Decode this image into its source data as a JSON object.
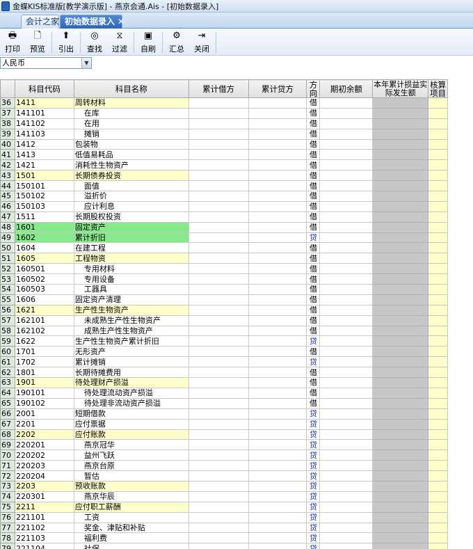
{
  "window": {
    "title": "金蝶KIS标准版[教学演示版] - 燕京会通.Ais - [初始数据录入]"
  },
  "tabs": [
    {
      "label": "会计之家"
    },
    {
      "label": "初始数据录入",
      "close": "✕"
    }
  ],
  "toolbar": [
    {
      "label": "打印",
      "icon": "printer-icon",
      "glyph": "🖶"
    },
    {
      "label": "预览",
      "icon": "preview-icon",
      "glyph": "🗋"
    },
    {
      "label": "引出",
      "icon": "export-icon",
      "glyph": "⬆"
    },
    {
      "label": "查找",
      "icon": "binoculars-icon",
      "glyph": "◎"
    },
    {
      "label": "过滤",
      "icon": "filter-icon",
      "glyph": "⧖"
    },
    {
      "label": "自刷",
      "icon": "refresh-icon",
      "glyph": "▣"
    },
    {
      "label": "汇总",
      "icon": "summary-icon",
      "glyph": "⚙"
    },
    {
      "label": "关闭",
      "icon": "close-door-icon",
      "glyph": "⇥"
    }
  ],
  "currency": {
    "selected": "人民币"
  },
  "columns": {
    "code": "科目代码",
    "name": "科目名称",
    "debit": "累计借方",
    "credit": "累计贷方",
    "direction": "方向",
    "opening": "期初余额",
    "pl": "本年累计损益实际发生额",
    "check": "核算项目"
  },
  "colors": {
    "level1_row": "#ffffcc",
    "selected_row": "#86e98c",
    "credit_text": "#1a2fb0"
  },
  "rows": [
    {
      "n": "36",
      "code": "1411",
      "name": "周转材料",
      "dir": "借",
      "lvl": 1
    },
    {
      "n": "37",
      "code": "141101",
      "name": "在库",
      "dir": "借",
      "lvl": 2
    },
    {
      "n": "38",
      "code": "141102",
      "name": "在用",
      "dir": "借",
      "lvl": 2
    },
    {
      "n": "39",
      "code": "141103",
      "name": "摊销",
      "dir": "借",
      "lvl": 2
    },
    {
      "n": "40",
      "code": "1412",
      "name": "包装物",
      "dir": "借",
      "lvl": 0
    },
    {
      "n": "41",
      "code": "1413",
      "name": "低值易耗品",
      "dir": "借",
      "lvl": 0
    },
    {
      "n": "42",
      "code": "1421",
      "name": "消耗性生物资产",
      "dir": "借",
      "lvl": 0
    },
    {
      "n": "43",
      "code": "1501",
      "name": "长期债券投资",
      "dir": "借",
      "lvl": 1
    },
    {
      "n": "44",
      "code": "150101",
      "name": "面值",
      "dir": "借",
      "lvl": 2
    },
    {
      "n": "45",
      "code": "150102",
      "name": "溢折价",
      "dir": "借",
      "lvl": 2
    },
    {
      "n": "46",
      "code": "150103",
      "name": "应计利息",
      "dir": "借",
      "lvl": 2
    },
    {
      "n": "47",
      "code": "1511",
      "name": "长期股权投资",
      "dir": "借",
      "lvl": 0
    },
    {
      "n": "48",
      "code": "1601",
      "name": "固定资产",
      "dir": "借",
      "lvl": 3
    },
    {
      "n": "49",
      "code": "1602",
      "name": "累计折旧",
      "dir": "贷",
      "lvl": 3
    },
    {
      "n": "50",
      "code": "1604",
      "name": "在建工程",
      "dir": "借",
      "lvl": 0
    },
    {
      "n": "51",
      "code": "1605",
      "name": "工程物资",
      "dir": "借",
      "lvl": 1
    },
    {
      "n": "52",
      "code": "160501",
      "name": "专用材料",
      "dir": "借",
      "lvl": 2
    },
    {
      "n": "53",
      "code": "160502",
      "name": "专用设备",
      "dir": "借",
      "lvl": 2
    },
    {
      "n": "54",
      "code": "160503",
      "name": "工器具",
      "dir": "借",
      "lvl": 2
    },
    {
      "n": "55",
      "code": "1606",
      "name": "固定资产清理",
      "dir": "借",
      "lvl": 0
    },
    {
      "n": "56",
      "code": "1621",
      "name": "生产性生物资产",
      "dir": "借",
      "lvl": 1
    },
    {
      "n": "57",
      "code": "162101",
      "name": "未成熟生产性生物资产",
      "dir": "借",
      "lvl": 2
    },
    {
      "n": "58",
      "code": "162102",
      "name": "成熟生产性生物资产",
      "dir": "借",
      "lvl": 2
    },
    {
      "n": "59",
      "code": "1622",
      "name": "生产性生物资产累计折旧",
      "dir": "贷",
      "lvl": 0
    },
    {
      "n": "60",
      "code": "1701",
      "name": "无形资产",
      "dir": "借",
      "lvl": 0
    },
    {
      "n": "61",
      "code": "1702",
      "name": "累计摊销",
      "dir": "贷",
      "lvl": 0
    },
    {
      "n": "62",
      "code": "1801",
      "name": "长期待摊费用",
      "dir": "借",
      "lvl": 0
    },
    {
      "n": "63",
      "code": "1901",
      "name": "待处理财产损溢",
      "dir": "借",
      "lvl": 1
    },
    {
      "n": "64",
      "code": "190101",
      "name": "待处理流动资产损溢",
      "dir": "借",
      "lvl": 2
    },
    {
      "n": "65",
      "code": "190102",
      "name": "待处理非流动资产损溢",
      "dir": "借",
      "lvl": 2
    },
    {
      "n": "66",
      "code": "2001",
      "name": "短期借款",
      "dir": "贷",
      "lvl": 0
    },
    {
      "n": "67",
      "code": "2201",
      "name": "应付票据",
      "dir": "贷",
      "lvl": 0
    },
    {
      "n": "68",
      "code": "2202",
      "name": "应付账款",
      "dir": "贷",
      "lvl": 1
    },
    {
      "n": "69",
      "code": "220201",
      "name": "燕京冠华",
      "dir": "贷",
      "lvl": 2
    },
    {
      "n": "70",
      "code": "220202",
      "name": "益州飞跃",
      "dir": "贷",
      "lvl": 2
    },
    {
      "n": "71",
      "code": "220203",
      "name": "燕京台原",
      "dir": "贷",
      "lvl": 2
    },
    {
      "n": "72",
      "code": "220204",
      "name": "暂估",
      "dir": "贷",
      "lvl": 2
    },
    {
      "n": "73",
      "code": "2203",
      "name": "预收账款",
      "dir": "贷",
      "lvl": 1
    },
    {
      "n": "74",
      "code": "220301",
      "name": "燕京华辰",
      "dir": "贷",
      "lvl": 2
    },
    {
      "n": "75",
      "code": "2211",
      "name": "应付职工薪酬",
      "dir": "贷",
      "lvl": 1
    },
    {
      "n": "76",
      "code": "221101",
      "name": "工资",
      "dir": "贷",
      "lvl": 2
    },
    {
      "n": "77",
      "code": "221102",
      "name": "奖金、津贴和补贴",
      "dir": "贷",
      "lvl": 2
    },
    {
      "n": "78",
      "code": "221103",
      "name": "福利费",
      "dir": "贷",
      "lvl": 2
    },
    {
      "n": "79",
      "code": "221104",
      "name": "社保",
      "dir": "贷",
      "lvl": 2
    }
  ]
}
